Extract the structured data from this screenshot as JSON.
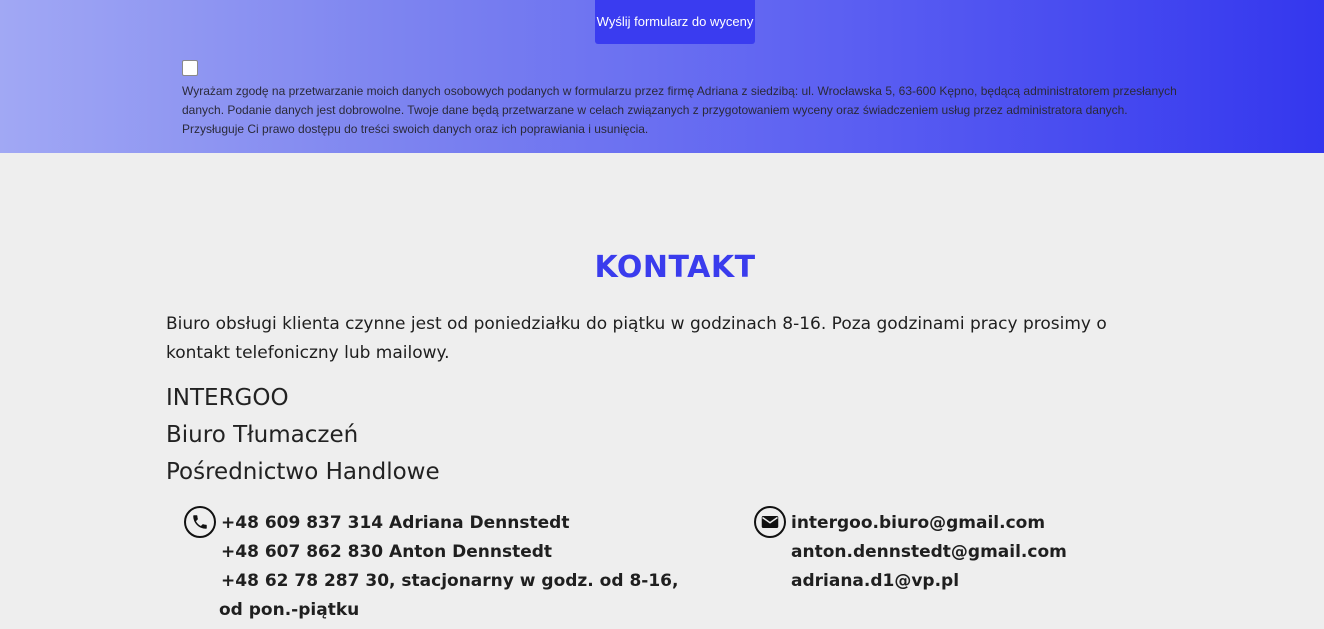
{
  "quote_form": {
    "submit_label": "Wyślij formularz do wyceny",
    "consent_checked": false,
    "consent_text": "Wyrażam zgodę na przetwarzanie moich danych osobowych podanych w formularzu przez firmę Adriana z siedzibą: ul. Wrocławska 5, 63-600 Kępno, będącą administratorem przesłanych danych. Podanie danych jest dobrowolne. Twoje dane będą przetwarzane w celach związanych z przygotowaniem wyceny oraz świadczeniem usług przez administratora danych. Przysługuje Ci prawo dostępu do treści swoich danych oraz ich poprawiania i usunięcia."
  },
  "contact": {
    "title": "KONTAKT",
    "intro": "Biuro obsługi klienta czynne jest od poniedziałku do piątku w godzinach 8-16. Poza godzinami pracy prosimy o kontakt telefoniczny lub mailowy.",
    "company_lines": [
      "INTERGOO",
      "Biuro Tłumaczeń",
      "Pośrednictwo Handlowe"
    ],
    "phones": [
      "+48 609 837 314 Adriana Dennstedt",
      "+48 607 862 830 Anton Dennstedt",
      "+48 62 78 287 30, stacjonarny w godz. od 8-16,",
      "od pon.-piątku"
    ],
    "emails": [
      "intergoo.biuro@gmail.com",
      "anton.dennstedt@gmail.com",
      "adriana.d1@vp.pl"
    ]
  },
  "icons": {
    "phone": "phone-icon",
    "email": "envelope-icon"
  },
  "colors": {
    "accent": "#3a3ced",
    "gradient_start": "#a1a8f4",
    "gradient_end": "#3437ee",
    "background": "#eeeeee"
  }
}
